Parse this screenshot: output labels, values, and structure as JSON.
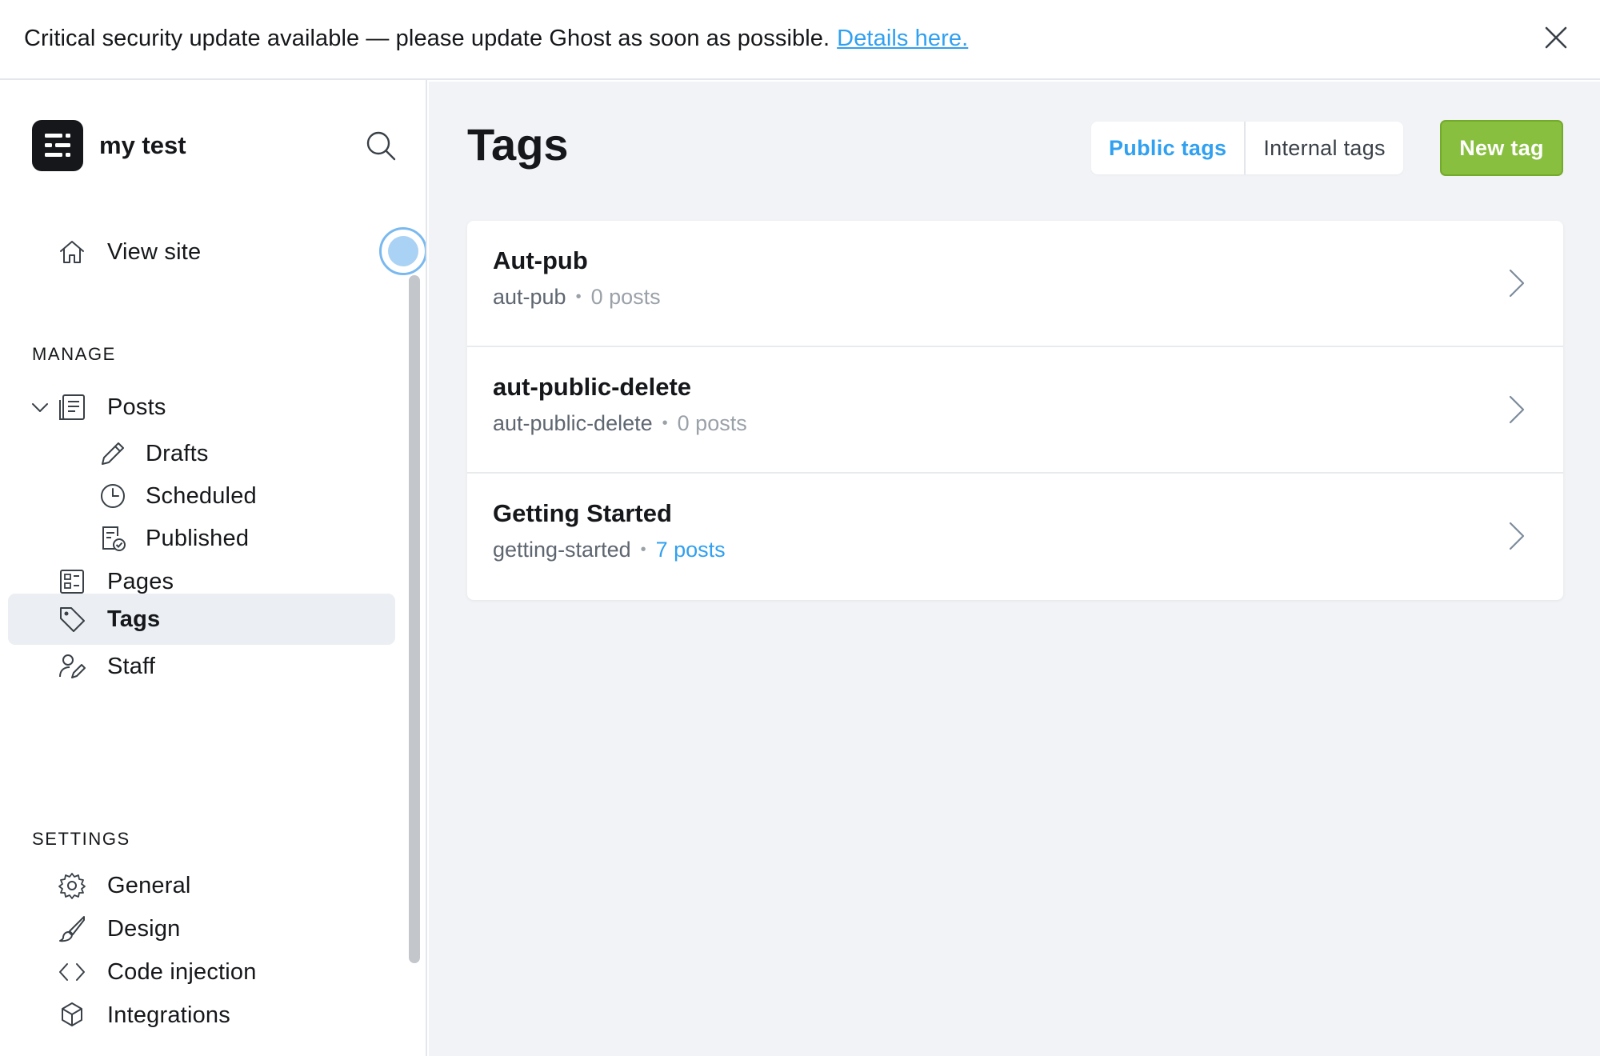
{
  "banner": {
    "message": "Critical security update available — please update Ghost as soon as possible.",
    "link_label": "Details here."
  },
  "sidebar": {
    "site_name": "my test",
    "view_site_label": "View site",
    "manage_title": "MANAGE",
    "manage_items": {
      "posts": "Posts",
      "drafts": "Drafts",
      "scheduled": "Scheduled",
      "published": "Published",
      "pages": "Pages",
      "tags": "Tags",
      "staff": "Staff"
    },
    "settings_title": "SETTINGS",
    "settings_items": {
      "general": "General",
      "design": "Design",
      "code_injection": "Code injection",
      "integrations": "Integrations"
    },
    "active_item": "Tags"
  },
  "main": {
    "title": "Tags",
    "filter_tabs": [
      "Public tags",
      "Internal tags"
    ],
    "active_filter": "Public tags",
    "new_tag_label": "New tag",
    "tags": [
      {
        "name": "Aut-pub",
        "slug": "aut-pub",
        "separator": "•",
        "count": "0 posts"
      },
      {
        "name": "aut-public-delete",
        "slug": "aut-public-delete",
        "separator": "•",
        "count": "0 posts"
      },
      {
        "name": "Getting Started",
        "slug": "getting-started",
        "separator": "•",
        "count": "7 posts"
      }
    ]
  },
  "colors": {
    "accent_blue": "#30a0f0",
    "primary_green": "#88bf3e",
    "active_nav_bg": "#ebeef2",
    "main_bg": "#f1f3f6"
  }
}
